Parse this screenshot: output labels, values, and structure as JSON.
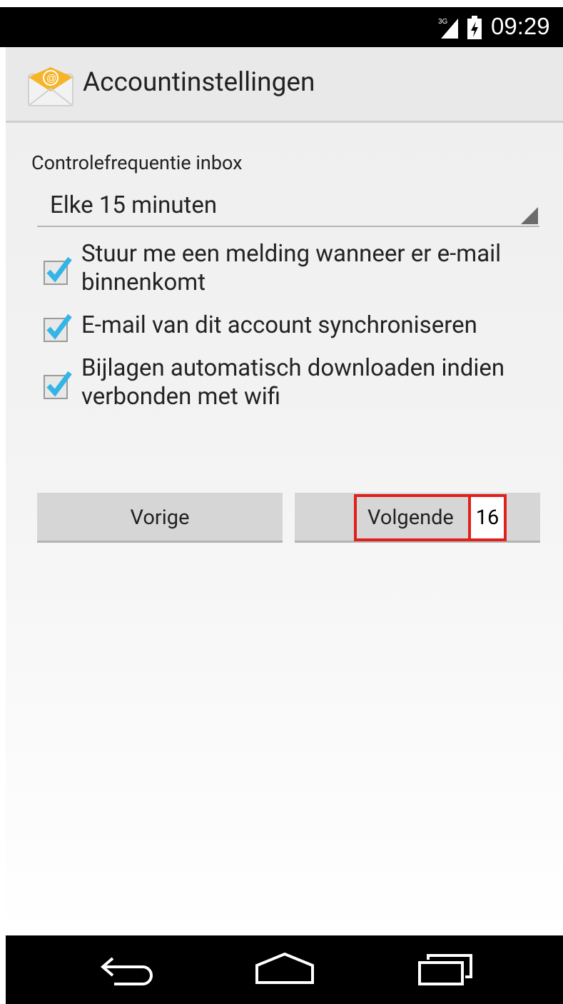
{
  "status_bar": {
    "network": "3G",
    "time": "09:29",
    "icons": [
      "signal-icon",
      "battery-icon"
    ]
  },
  "action_bar": {
    "icon": "email-app-icon",
    "title": "Accountinstellingen"
  },
  "sync": {
    "frequency_label": "Controlefrequentie inbox",
    "frequency_value": "Elke 15 minuten"
  },
  "options": [
    {
      "label": "Stuur me een melding wanneer er e-mail binnenkomt",
      "checked": true
    },
    {
      "label": "E-mail van dit account synchroniseren",
      "checked": true
    },
    {
      "label": "Bijlagen automatisch downloaden indien verbonden met wifi",
      "checked": true
    }
  ],
  "buttons": {
    "prev_label": "Vorige",
    "next_label": "Volgende"
  },
  "annotation": {
    "step": "16",
    "color": "#e0201b"
  },
  "colors": {
    "checkmark": "#33b5e5",
    "action_bar": "#e9e9e9",
    "status_bar": "#000000"
  },
  "nav_bar": {
    "icons": [
      "back-icon",
      "home-icon",
      "recents-icon"
    ]
  }
}
